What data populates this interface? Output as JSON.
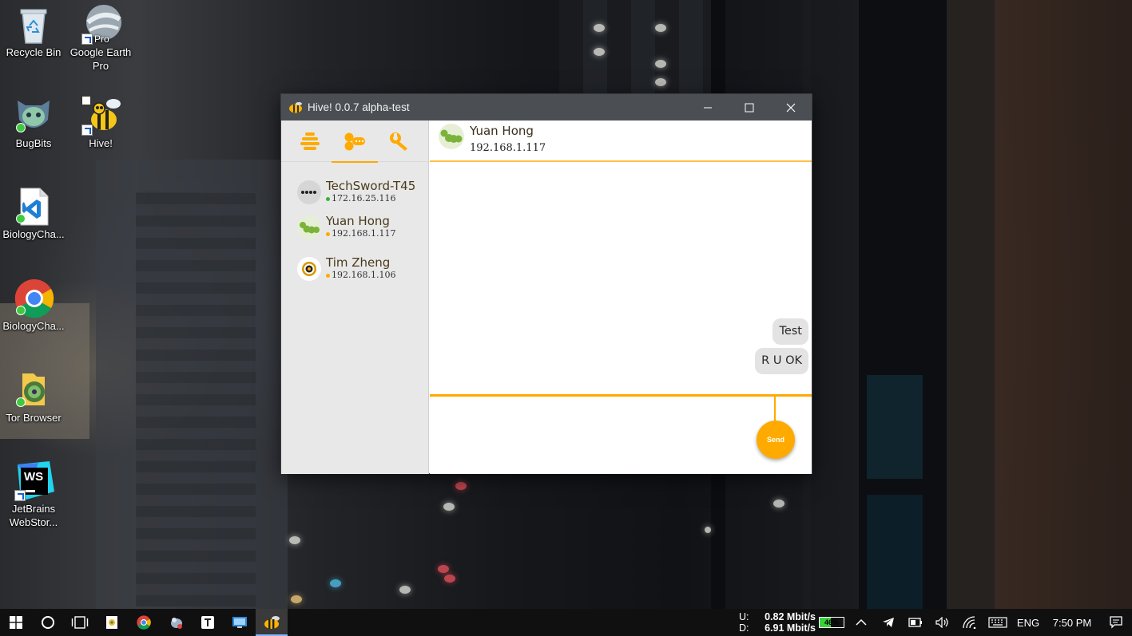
{
  "desktop": {
    "icons": [
      {
        "label": "Recycle Bin",
        "icon": "recycle-bin-icon"
      },
      {
        "label": "Google Earth Pro",
        "icon": "google-earth-icon",
        "overlay": "Pro"
      },
      {
        "label": "BugBits",
        "icon": "bugbits-icon"
      },
      {
        "label": "Hive!",
        "icon": "hive-bee-icon"
      },
      {
        "label": "BiologyCha...",
        "icon": "vscode-icon"
      },
      {
        "label": "BiologyCha...",
        "icon": "chrome-icon"
      },
      {
        "label": "Tor Browser",
        "icon": "tor-browser-icon"
      },
      {
        "label": "JetBrains WebStor...",
        "icon": "webstorm-icon",
        "overlay": "WS"
      }
    ]
  },
  "window": {
    "title": "Hive! 0.0.7 alpha-test",
    "accent": "#ffaa00",
    "tabs": [
      {
        "name": "hive-tab",
        "icon": "hive-stack-icon",
        "active": false
      },
      {
        "name": "contacts-tab",
        "icon": "contacts-icon",
        "active": true
      },
      {
        "name": "settings-tab",
        "icon": "wrench-icon",
        "active": false
      }
    ],
    "contacts": [
      {
        "name": "TechSword-T45",
        "ip": "172.16.25.116",
        "status_color": "#3ab03a",
        "avatar": "dots-avatar"
      },
      {
        "name": "Yuan Hong",
        "ip": "192.168.1.117",
        "status_color": "#ffaa00",
        "avatar": "caterpillar-avatar"
      },
      {
        "name": "Tim Zheng",
        "ip": "192.168.1.106",
        "status_color": "#ffaa00",
        "avatar": "target-avatar"
      }
    ],
    "chat": {
      "name": "Yuan Hong",
      "ip": "192.168.1.117",
      "messages": [
        "Test",
        "R U OK"
      ],
      "send_label": "Send"
    }
  },
  "taskbar": {
    "upload_label": "U:",
    "download_label": "D:",
    "upload_speed": "0.82 Mbit/s",
    "download_speed": "6.91 Mbit/s",
    "battery": "46%",
    "language": "ENG",
    "time": "7:50 PM"
  }
}
